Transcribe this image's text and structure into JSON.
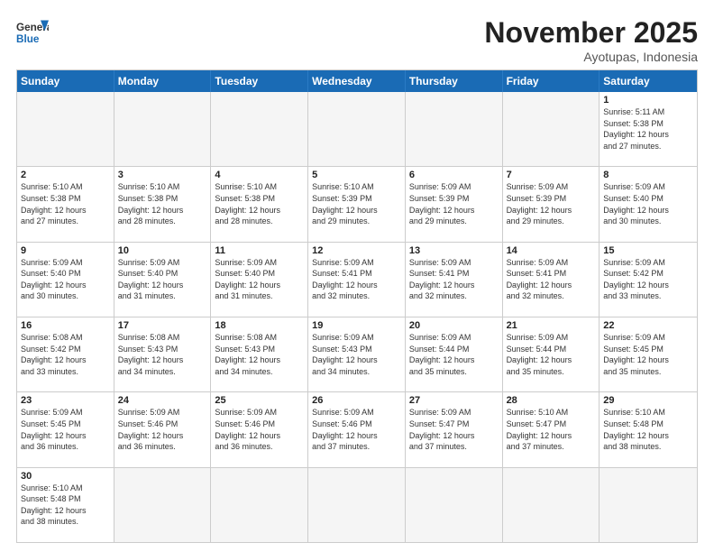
{
  "header": {
    "logo_general": "General",
    "logo_blue": "Blue",
    "month_title": "November 2025",
    "location": "Ayotupas, Indonesia"
  },
  "days_of_week": [
    "Sunday",
    "Monday",
    "Tuesday",
    "Wednesday",
    "Thursday",
    "Friday",
    "Saturday"
  ],
  "weeks": [
    [
      {
        "num": "",
        "info": ""
      },
      {
        "num": "",
        "info": ""
      },
      {
        "num": "",
        "info": ""
      },
      {
        "num": "",
        "info": ""
      },
      {
        "num": "",
        "info": ""
      },
      {
        "num": "",
        "info": ""
      },
      {
        "num": "1",
        "info": "Sunrise: 5:11 AM\nSunset: 5:38 PM\nDaylight: 12 hours\nand 27 minutes."
      }
    ],
    [
      {
        "num": "2",
        "info": "Sunrise: 5:10 AM\nSunset: 5:38 PM\nDaylight: 12 hours\nand 27 minutes."
      },
      {
        "num": "3",
        "info": "Sunrise: 5:10 AM\nSunset: 5:38 PM\nDaylight: 12 hours\nand 28 minutes."
      },
      {
        "num": "4",
        "info": "Sunrise: 5:10 AM\nSunset: 5:38 PM\nDaylight: 12 hours\nand 28 minutes."
      },
      {
        "num": "5",
        "info": "Sunrise: 5:10 AM\nSunset: 5:39 PM\nDaylight: 12 hours\nand 29 minutes."
      },
      {
        "num": "6",
        "info": "Sunrise: 5:09 AM\nSunset: 5:39 PM\nDaylight: 12 hours\nand 29 minutes."
      },
      {
        "num": "7",
        "info": "Sunrise: 5:09 AM\nSunset: 5:39 PM\nDaylight: 12 hours\nand 29 minutes."
      },
      {
        "num": "8",
        "info": "Sunrise: 5:09 AM\nSunset: 5:40 PM\nDaylight: 12 hours\nand 30 minutes."
      }
    ],
    [
      {
        "num": "9",
        "info": "Sunrise: 5:09 AM\nSunset: 5:40 PM\nDaylight: 12 hours\nand 30 minutes."
      },
      {
        "num": "10",
        "info": "Sunrise: 5:09 AM\nSunset: 5:40 PM\nDaylight: 12 hours\nand 31 minutes."
      },
      {
        "num": "11",
        "info": "Sunrise: 5:09 AM\nSunset: 5:40 PM\nDaylight: 12 hours\nand 31 minutes."
      },
      {
        "num": "12",
        "info": "Sunrise: 5:09 AM\nSunset: 5:41 PM\nDaylight: 12 hours\nand 32 minutes."
      },
      {
        "num": "13",
        "info": "Sunrise: 5:09 AM\nSunset: 5:41 PM\nDaylight: 12 hours\nand 32 minutes."
      },
      {
        "num": "14",
        "info": "Sunrise: 5:09 AM\nSunset: 5:41 PM\nDaylight: 12 hours\nand 32 minutes."
      },
      {
        "num": "15",
        "info": "Sunrise: 5:09 AM\nSunset: 5:42 PM\nDaylight: 12 hours\nand 33 minutes."
      }
    ],
    [
      {
        "num": "16",
        "info": "Sunrise: 5:08 AM\nSunset: 5:42 PM\nDaylight: 12 hours\nand 33 minutes."
      },
      {
        "num": "17",
        "info": "Sunrise: 5:08 AM\nSunset: 5:43 PM\nDaylight: 12 hours\nand 34 minutes."
      },
      {
        "num": "18",
        "info": "Sunrise: 5:08 AM\nSunset: 5:43 PM\nDaylight: 12 hours\nand 34 minutes."
      },
      {
        "num": "19",
        "info": "Sunrise: 5:09 AM\nSunset: 5:43 PM\nDaylight: 12 hours\nand 34 minutes."
      },
      {
        "num": "20",
        "info": "Sunrise: 5:09 AM\nSunset: 5:44 PM\nDaylight: 12 hours\nand 35 minutes."
      },
      {
        "num": "21",
        "info": "Sunrise: 5:09 AM\nSunset: 5:44 PM\nDaylight: 12 hours\nand 35 minutes."
      },
      {
        "num": "22",
        "info": "Sunrise: 5:09 AM\nSunset: 5:45 PM\nDaylight: 12 hours\nand 35 minutes."
      }
    ],
    [
      {
        "num": "23",
        "info": "Sunrise: 5:09 AM\nSunset: 5:45 PM\nDaylight: 12 hours\nand 36 minutes."
      },
      {
        "num": "24",
        "info": "Sunrise: 5:09 AM\nSunset: 5:46 PM\nDaylight: 12 hours\nand 36 minutes."
      },
      {
        "num": "25",
        "info": "Sunrise: 5:09 AM\nSunset: 5:46 PM\nDaylight: 12 hours\nand 36 minutes."
      },
      {
        "num": "26",
        "info": "Sunrise: 5:09 AM\nSunset: 5:46 PM\nDaylight: 12 hours\nand 37 minutes."
      },
      {
        "num": "27",
        "info": "Sunrise: 5:09 AM\nSunset: 5:47 PM\nDaylight: 12 hours\nand 37 minutes."
      },
      {
        "num": "28",
        "info": "Sunrise: 5:10 AM\nSunset: 5:47 PM\nDaylight: 12 hours\nand 37 minutes."
      },
      {
        "num": "29",
        "info": "Sunrise: 5:10 AM\nSunset: 5:48 PM\nDaylight: 12 hours\nand 38 minutes."
      }
    ],
    [
      {
        "num": "30",
        "info": "Sunrise: 5:10 AM\nSunset: 5:48 PM\nDaylight: 12 hours\nand 38 minutes."
      },
      {
        "num": "",
        "info": ""
      },
      {
        "num": "",
        "info": ""
      },
      {
        "num": "",
        "info": ""
      },
      {
        "num": "",
        "info": ""
      },
      {
        "num": "",
        "info": ""
      },
      {
        "num": "",
        "info": ""
      }
    ]
  ]
}
